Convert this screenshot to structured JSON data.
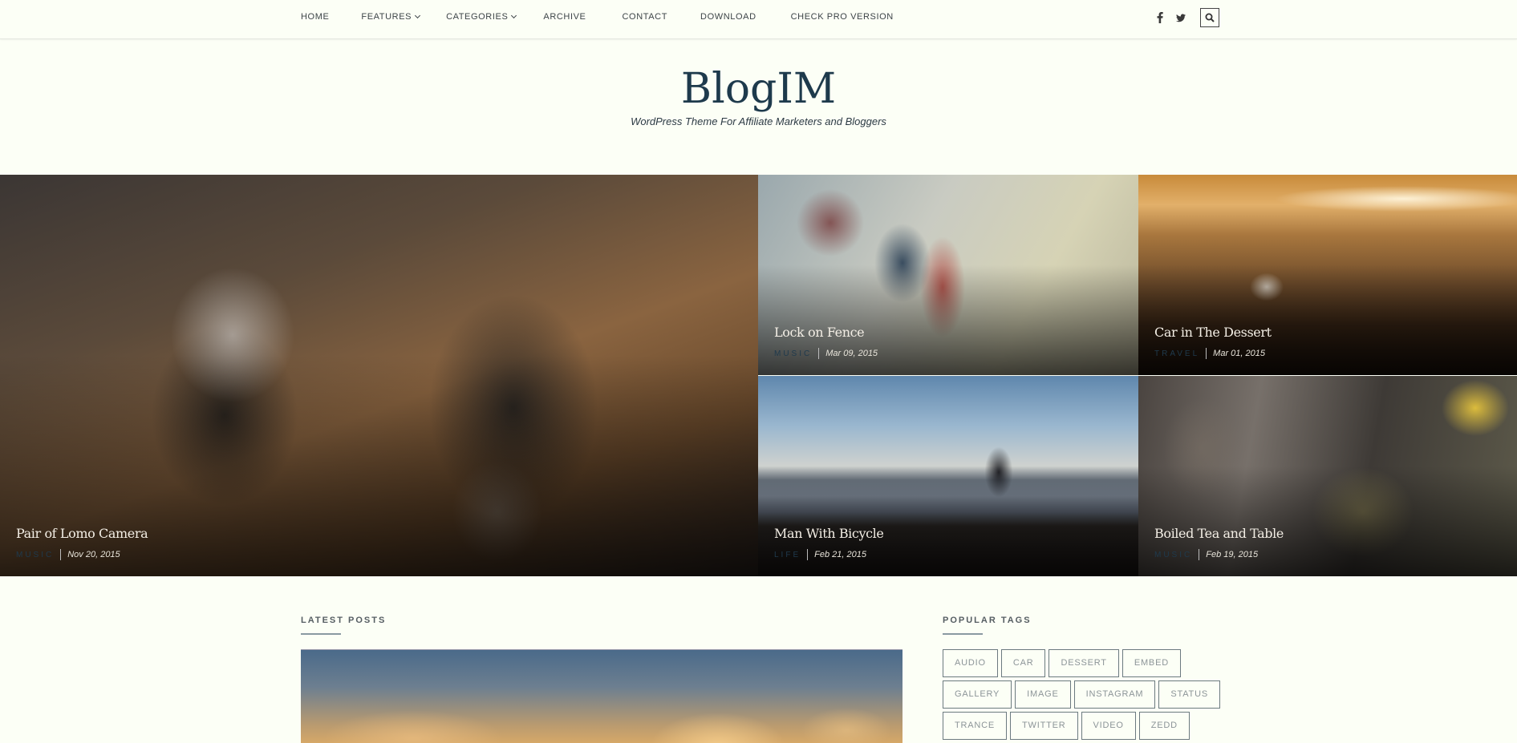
{
  "nav": {
    "items": [
      {
        "label": "HOME",
        "dropdown": false
      },
      {
        "label": "FEATURES",
        "dropdown": true
      },
      {
        "label": "CATEGORIES",
        "dropdown": true
      },
      {
        "label": "ARCHIVE",
        "dropdown": false
      },
      {
        "label": "CONTACT",
        "dropdown": false
      },
      {
        "label": "DOWNLOAD",
        "dropdown": false
      },
      {
        "label": "CHECK PRO VERSION",
        "dropdown": false
      }
    ],
    "social": [
      {
        "icon": "facebook-icon",
        "glyph": "f"
      },
      {
        "icon": "twitter-icon",
        "glyph": "twitter"
      }
    ],
    "search_icon": "search-icon"
  },
  "branding": {
    "title": "BlogIM",
    "tagline": "WordPress Theme For Affiliate Marketers and Bloggers"
  },
  "hero": [
    {
      "title": "Pair of Lomo Camera",
      "category": "MUSIC",
      "date": "Nov 20, 2015"
    },
    {
      "title": "Lock on Fence",
      "category": "MUSIC",
      "date": "Mar 09, 2015"
    },
    {
      "title": "Car in The Dessert",
      "category": "TRAVEL",
      "date": "Mar 01, 2015"
    },
    {
      "title": "Man With Bicycle",
      "category": "LIFE",
      "date": "Feb 21, 2015"
    },
    {
      "title": "Boiled Tea and Table",
      "category": "MUSIC",
      "date": "Feb 19, 2015"
    }
  ],
  "latest_posts": {
    "heading": "LATEST POSTS"
  },
  "popular_tags": {
    "heading": "POPULAR TAGS",
    "rows": [
      [
        "AUDIO",
        "CAR",
        "DESSERT",
        "EMBED"
      ],
      [
        "GALLERY",
        "IMAGE",
        "INSTAGRAM",
        "STATUS"
      ],
      [
        "TRANCE",
        "TWITTER",
        "VIDEO",
        "ZEDD"
      ]
    ]
  },
  "colors": {
    "background": "#fcfff6",
    "title": "#1e3a4c",
    "category": "#1f3a4d",
    "tag_border": "#6c7a80"
  }
}
